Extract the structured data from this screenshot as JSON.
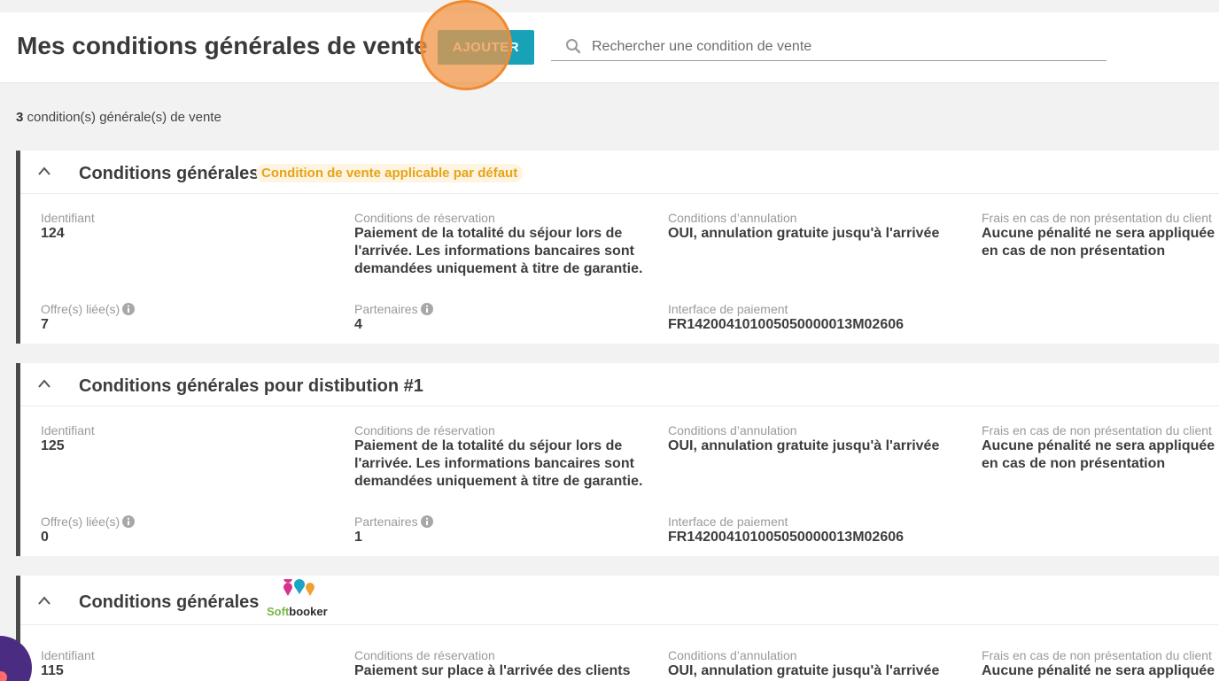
{
  "header": {
    "title": "Mes conditions générales de vente",
    "add_label": "AJOUTER",
    "search_placeholder": "Rechercher une condition de vente"
  },
  "summary": {
    "count": "3",
    "label": "condition(s) générale(s) de vente"
  },
  "labels": {
    "identifiant": "Identifiant",
    "reservation": "Conditions de réservation",
    "annulation": "Conditions d’annulation",
    "frais": "Frais en cas de non présentation du client",
    "offres": "Offre(s) liée(s)",
    "partenaires": "Partenaires",
    "paiement": "Interface de paiement"
  },
  "cards": [
    {
      "title": "Conditions générales",
      "badge": "Condition de vente applicable par défaut",
      "id": "124",
      "reservation": "Paiement de la totalité du séjour lors de l'arrivée. Les informations bancaires sont demandées uniquement à titre de garantie.",
      "annulation": "OUI, annulation gratuite jusqu'à l'arrivée",
      "frais": "Aucune pénalité ne sera appliquée en cas de non présentation",
      "offres": "7",
      "partenaires": "4",
      "paiement": "FR142004101005050000013M02606"
    },
    {
      "title": "Conditions générales pour distibution #1",
      "id": "125",
      "reservation": "Paiement de la totalité du séjour lors de l'arrivée. Les informations bancaires sont demandées uniquement à titre de garantie.",
      "annulation": "OUI, annulation gratuite jusqu'à l'arrivée",
      "frais": "Aucune pénalité ne sera appliquée en cas de non présentation",
      "offres": "0",
      "partenaires": "1",
      "paiement": "FR142004101005050000013M02606"
    },
    {
      "title": "Conditions générales",
      "logo_soft": "Soft",
      "logo_booker": "booker",
      "id": "115",
      "reservation": "Paiement sur place à l'arrivée des clients",
      "annulation": "OUI, annulation gratuite jusqu'à l'arrivée",
      "frais": "Aucune pénalité ne sera appliquée en cas de non présentation"
    }
  ],
  "colors": {
    "accent": "#17a2b8",
    "badge_text": "#e8a317",
    "badge_bg": "#fdf4e1",
    "card_border": "#4a4a4a"
  },
  "icons": [
    "search-icon",
    "chevron-up-icon",
    "info-icon",
    "softbooker-logo",
    "chat-icon"
  ]
}
